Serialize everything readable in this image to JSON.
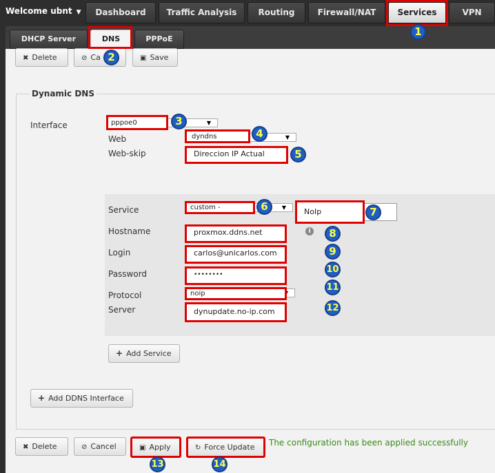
{
  "top_nav": {
    "welcome": "Welcome ubnt",
    "tabs": [
      "Dashboard",
      "Traffic Analysis",
      "Routing",
      "Firewall/NAT",
      "Services",
      "VPN"
    ],
    "active_tab": "Services"
  },
  "sub_tabs": {
    "tabs": [
      "DHCP Server",
      "DNS",
      "PPPoE"
    ],
    "active_tab": "DNS"
  },
  "top_toolbar": {
    "delete": "Delete",
    "cancel": "Ca",
    "save": "Save"
  },
  "dynamic_dns": {
    "legend": "Dynamic DNS",
    "interface_label": "Interface",
    "interface_value": "pppoe0",
    "web_label": "Web",
    "web_value": "dyndns",
    "web_skip_label": "Web-skip",
    "web_skip_value": "Direccion IP Actual",
    "service": {
      "service_label": "Service",
      "service_value": "custom -",
      "custom_name": "NoIp",
      "hostname_label": "Hostname",
      "hostname_value": "proxmox.ddns.net",
      "login_label": "Login",
      "login_value": "carlos@unicarlos.com",
      "password_label": "Password",
      "password_value": "••••••••",
      "protocol_label": "Protocol",
      "protocol_value": "noip",
      "server_label": "Server",
      "server_value": "dynupdate.no-ip.com",
      "add_service": "Add Service"
    },
    "add_interface": "Add DDNS Interface"
  },
  "bottom_toolbar": {
    "delete": "Delete",
    "cancel": "Cancel",
    "apply": "Apply",
    "force_update": "Force Update",
    "status": "The configuration has been applied successfully"
  },
  "annotations": [
    "1",
    "2",
    "3",
    "4",
    "5",
    "6",
    "7",
    "8",
    "9",
    "10",
    "11",
    "12",
    "13",
    "14"
  ],
  "colors": {
    "highlight": "#e00000",
    "badge": "#1f5fc4",
    "badge_text": "#ffff4d",
    "success": "#3a8a16"
  }
}
